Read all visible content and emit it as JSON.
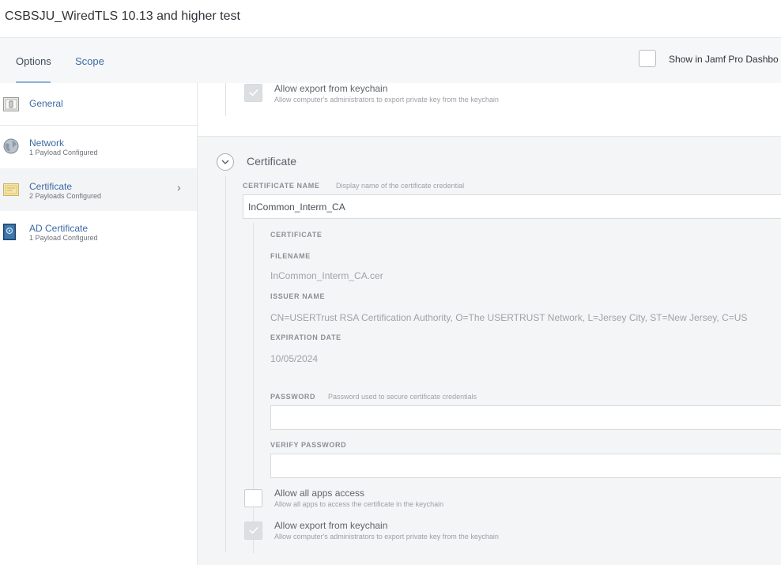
{
  "page": {
    "title": "CSBSJU_WiredTLS 10.13 and higher test"
  },
  "tabs": {
    "options": "Options",
    "scope": "Scope"
  },
  "dashboard": {
    "label": "Show in Jamf Pro Dashbo"
  },
  "sidebar": {
    "items": [
      {
        "label": "General",
        "sub": "",
        "icon": "switch-icon"
      },
      {
        "label": "Network",
        "sub": "1 Payload Configured",
        "icon": "globe-icon"
      },
      {
        "label": "Certificate",
        "sub": "2 Payloads Configured",
        "icon": "certificate-icon"
      },
      {
        "label": "AD Certificate",
        "sub": "1 Payload Configured",
        "icon": "ad-certificate-icon"
      }
    ]
  },
  "top_options": {
    "export_title": "Allow export from keychain",
    "export_desc": "Allow computer's administrators to export private key from the keychain"
  },
  "certificate_section": {
    "title": "Certificate",
    "name_label": "CERTIFICATE NAME",
    "name_hint": "Display name of the certificate credential",
    "name_value": "InCommon_Interm_CA",
    "cert_label": "CERTIFICATE",
    "filename_label": "FILENAME",
    "filename_value": "InCommon_Interm_CA.cer",
    "issuer_label": "ISSUER NAME",
    "issuer_value": "CN=USERTrust RSA Certification Authority, O=The USERTRUST Network, L=Jersey City, ST=New Jersey, C=US",
    "expiration_label": "EXPIRATION DATE",
    "expiration_value": "10/05/2024",
    "password_label": "PASSWORD",
    "password_hint": "Password used to secure certificate credentials",
    "verify_label": "VERIFY PASSWORD",
    "all_apps_title": "Allow all apps access",
    "all_apps_desc": "Allow all apps to access the certificate in the keychain",
    "export_title": "Allow export from keychain",
    "export_desc": "Allow computer's administrators to export private key from the keychain"
  }
}
